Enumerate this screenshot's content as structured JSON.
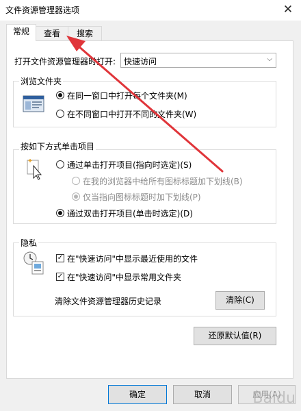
{
  "window": {
    "title": "文件资源管理器选项",
    "close_glyph": "✕"
  },
  "tabs": [
    {
      "label": "常规",
      "active": true
    },
    {
      "label": "查看",
      "active": false
    },
    {
      "label": "搜索",
      "active": false
    }
  ],
  "open_in": {
    "label": "打开文件资源管理器时打开:",
    "value": "快速访问",
    "arrow": "⌵"
  },
  "browse_folders": {
    "title": "浏览文件夹",
    "options": [
      {
        "label": "在同一窗口中打开每个文件夹(M)",
        "checked": true
      },
      {
        "label": "在不同窗口中打开不同的文件夹(W)",
        "checked": false
      }
    ]
  },
  "click_items": {
    "title": "按如下方式单击项目",
    "single_click": {
      "label": "通过单击打开项目(指向时选定)(S)",
      "checked": false
    },
    "underline_browser": {
      "label": "在我的浏览器中给所有图标标题加下划线(B)",
      "checked": false
    },
    "underline_point": {
      "label": "仅当指向图标标题时加下划线(P)",
      "checked": true
    },
    "double_click": {
      "label": "通过双击打开项目(单击时选定)(D)",
      "checked": true
    }
  },
  "privacy": {
    "title": "隐私",
    "recent_files": {
      "label": "在\"快速访问\"中显示最近使用的文件",
      "checked": true
    },
    "frequent_folders": {
      "label": "在\"快速访问\"中显示常用文件夹",
      "checked": true
    },
    "clear_label": "清除文件资源管理器历史记录",
    "clear_button": "清除(C)"
  },
  "restore_defaults": "还原默认值(R)",
  "footer": {
    "ok": "确定",
    "cancel": "取消",
    "apply": "应用(A)"
  },
  "colors": {
    "annotation_arrow": "#e0353a",
    "accent": "#0078d7"
  }
}
